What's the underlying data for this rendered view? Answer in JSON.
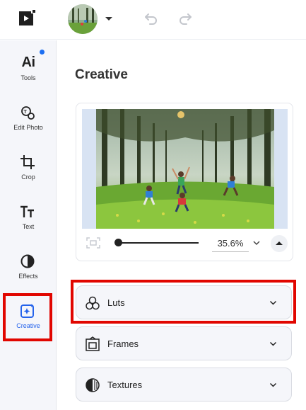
{
  "topbar": {
    "logo_icon": "play-logo-icon",
    "avatar_icon": "forest-avatar",
    "undo_icon": "undo-icon",
    "redo_icon": "redo-icon"
  },
  "sidebar": {
    "items": [
      {
        "label": "Tools",
        "icon": "ai-icon",
        "has_dot": true
      },
      {
        "label": "Edit Photo",
        "icon": "edit-photo-icon"
      },
      {
        "label": "Crop",
        "icon": "crop-icon"
      },
      {
        "label": "Text",
        "icon": "text-icon"
      },
      {
        "label": "Effects",
        "icon": "effects-icon"
      },
      {
        "label": "Creative",
        "icon": "creative-icon",
        "active": true
      }
    ],
    "ai_text": "Ai",
    "active_color": "#2563eb",
    "highlight_color": "#e10600"
  },
  "main": {
    "title": "Creative",
    "preview": {
      "zoom": "35.6%",
      "zoom_level": 0.356
    },
    "accordions": [
      {
        "label": "Luts",
        "icon": "luts-icon",
        "highlighted": true
      },
      {
        "label": "Frames",
        "icon": "frames-icon"
      },
      {
        "label": "Textures",
        "icon": "textures-icon"
      }
    ]
  }
}
